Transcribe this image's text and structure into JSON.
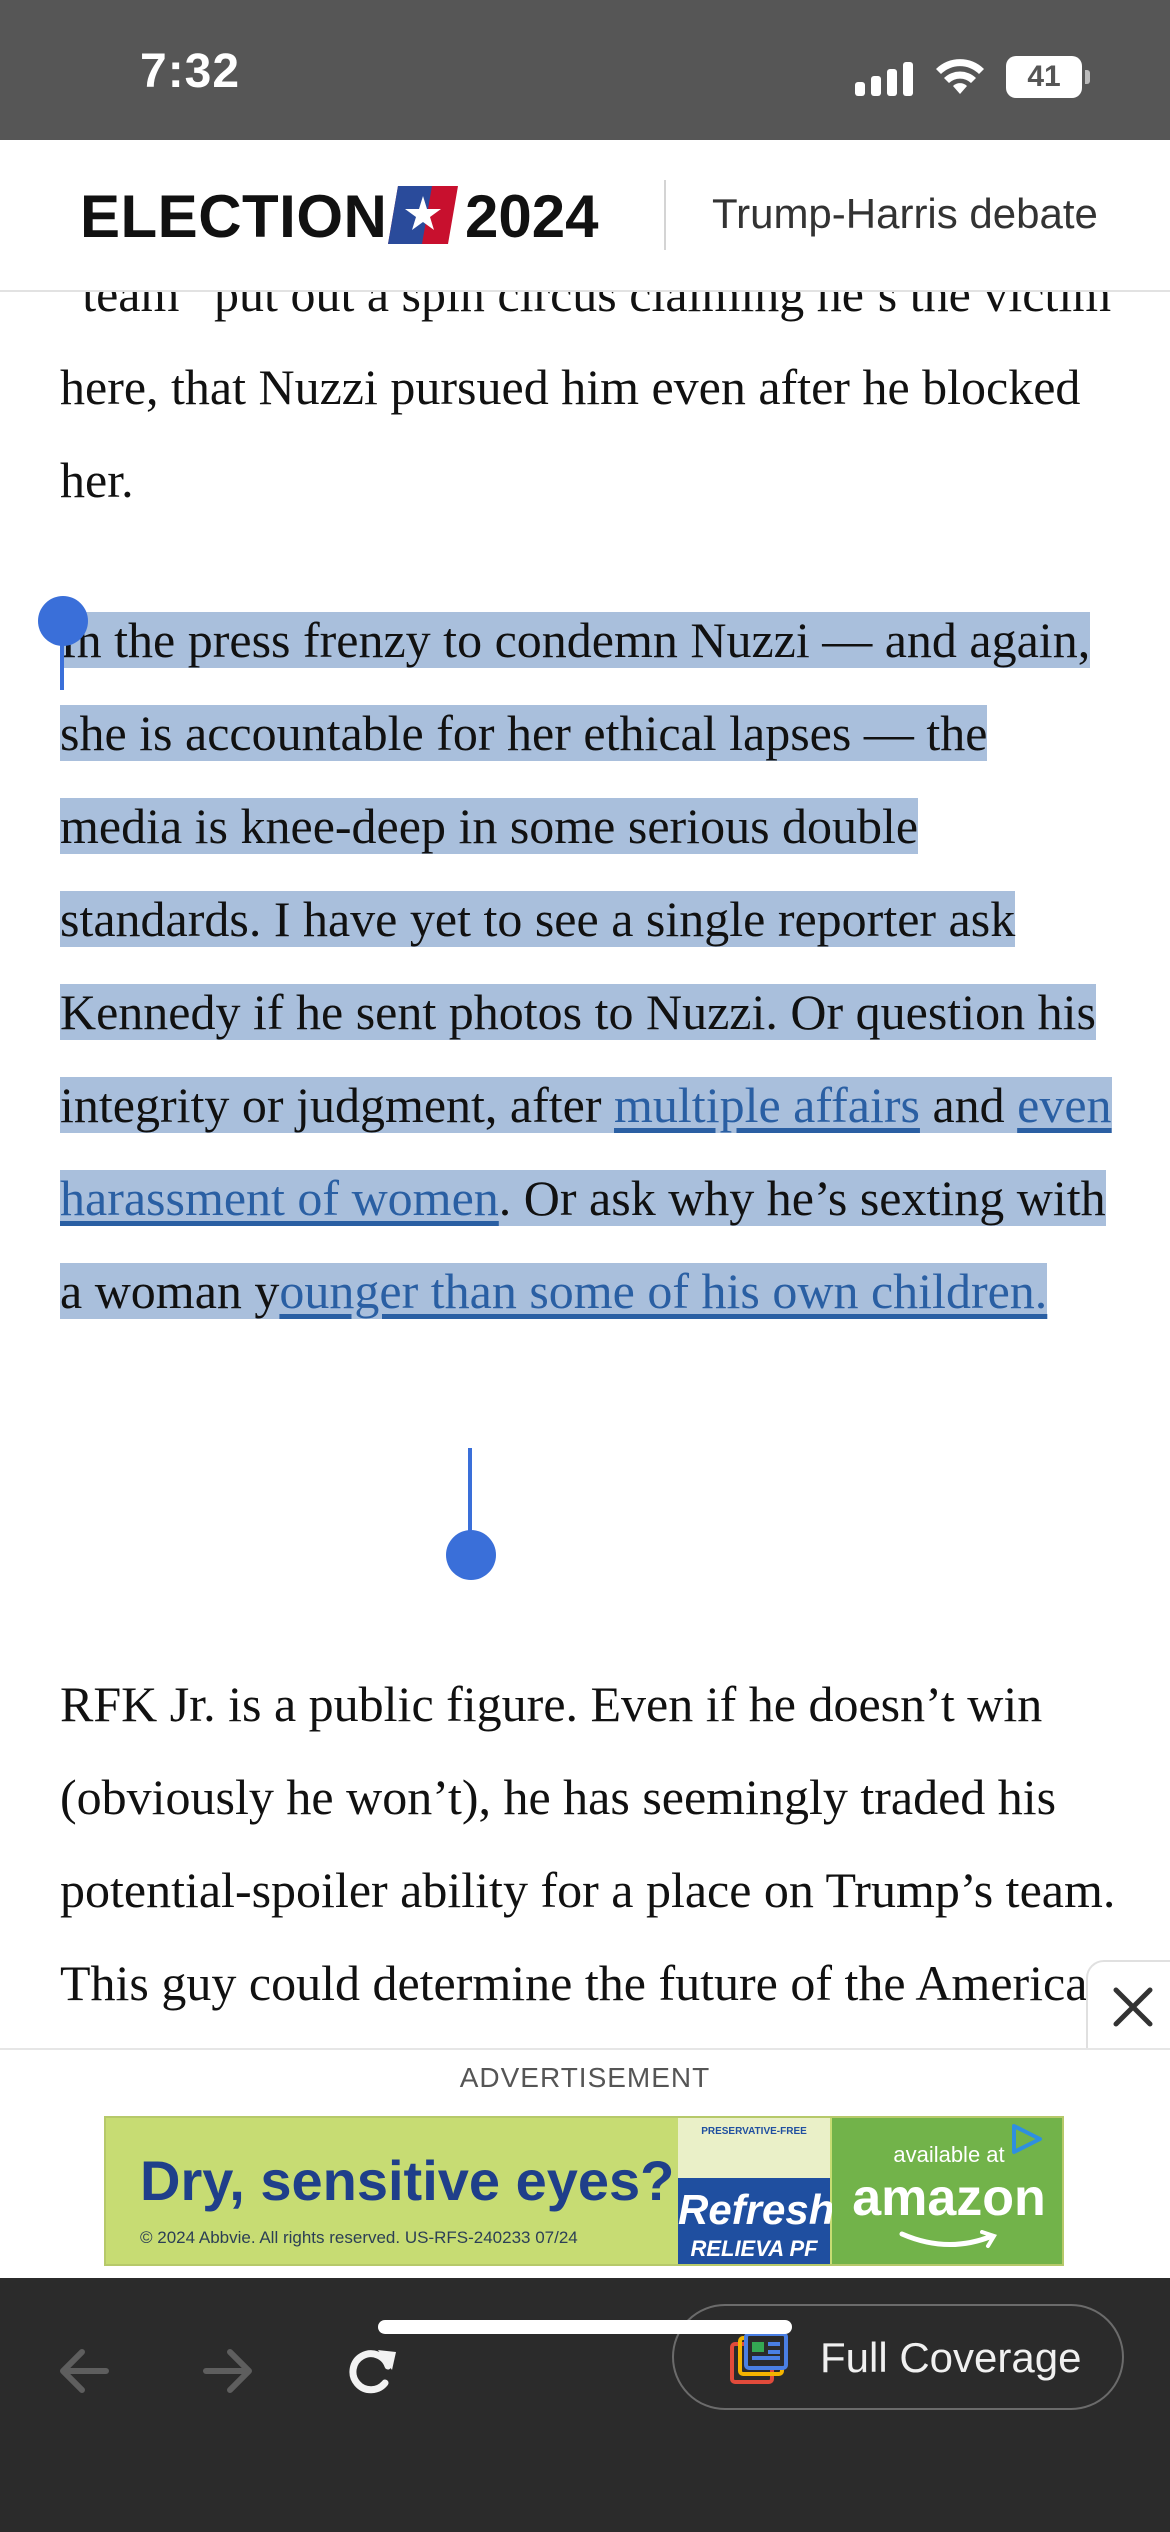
{
  "status_bar": {
    "time": "7:32",
    "battery": "41",
    "icons": [
      "signal-icon",
      "wifi-icon",
      "battery-icon"
    ]
  },
  "header": {
    "brand_word": "ELECTION",
    "brand_year": "2024",
    "logo_icon": "star-flag-icon",
    "topic": "Trump-Harris debate"
  },
  "article": {
    "para1": {
      "text": "“team” put out a spin circus claiming he’s the victim here, that Nuzzi pursued him even after he blocked her."
    },
    "para2": {
      "text_1": "In the press frenzy to condemn Nuzzi — and again, she is accountable for her ethical lapses — the media is knee-deep in some serious double standards. I have yet to see a single reporter ask Kennedy if he sent photos to Nuzzi. Or question his integrity or judgment, after ",
      "link_1": "multiple affairs",
      "text_2": " and ",
      "link_2": "even harassment of women",
      "text_3": ". Or ask why he’s sexting with a woman y",
      "link_3": "ounger than some of his own children.",
      "selected": true
    },
    "para3": {
      "text": "RFK Jr. is a public figure. Even if he doesn’t win (obviously he won’t), he has seemingly traded his potential-spoiler ability for a place on Trump’s team. This guy could determine the future of the American"
    }
  },
  "ad": {
    "label": "ADVERTISEMENT",
    "close_icon": "close-icon",
    "headline": "Dry, sensitive eyes?",
    "copyright": "© 2024 Abbvie. All rights reserved. US-RFS-240233 07/24",
    "product_tag": "PRESERVATIVE-FREE",
    "product_brand": "Refresh",
    "product_sub": "RELIEVA PF",
    "available": "available at",
    "retailer": "amazon",
    "adchoices_icon": "adchoices-icon"
  },
  "toolbar": {
    "back_icon": "back-arrow-icon",
    "forward_icon": "forward-arrow-icon",
    "reload_icon": "reload-icon",
    "full_coverage_label": "Full Coverage",
    "full_coverage_icon": "full-coverage-icon"
  },
  "colors": {
    "selection": "#a9bfdc",
    "link": "#2a5fa3",
    "handle": "#3a6fd9",
    "status_bar": "#565656",
    "toolbar": "#2b2b2b"
  }
}
